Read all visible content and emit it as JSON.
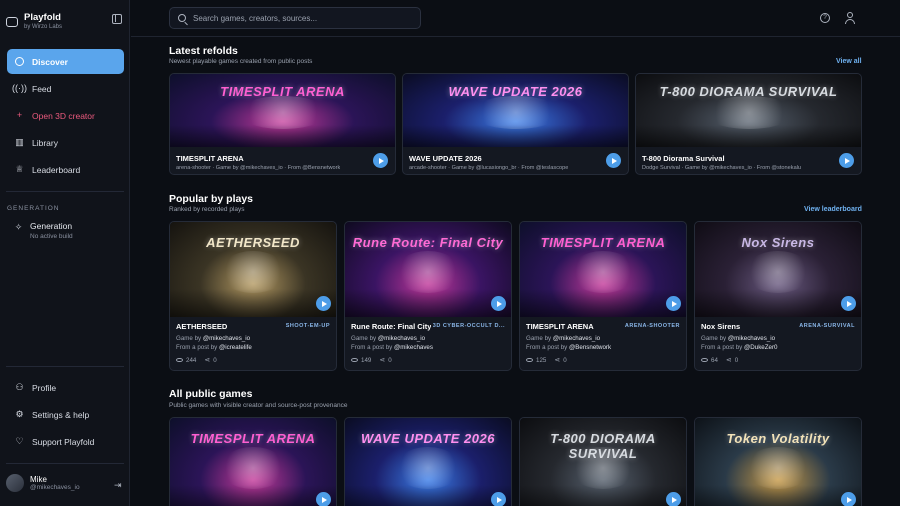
{
  "brand": {
    "name": "Playfold",
    "sub": "by Wirzo Labs"
  },
  "nav": [
    {
      "label": "Discover",
      "icon": "compass-icon"
    },
    {
      "label": "Feed",
      "icon": "broadcast-icon"
    },
    {
      "label": "Open 3D creator",
      "icon": "plus-icon"
    },
    {
      "label": "Library",
      "icon": "library-icon"
    },
    {
      "label": "Leaderboard",
      "icon": "trophy-icon"
    }
  ],
  "generation": {
    "section": "GENERATION",
    "title": "Generation",
    "status": "No active build"
  },
  "bottom_nav": [
    {
      "label": "Profile",
      "icon": "person-icon"
    },
    {
      "label": "Settings & help",
      "icon": "gear-icon"
    },
    {
      "label": "Support Playfold",
      "icon": "heart-icon"
    }
  ],
  "user": {
    "name": "Mike",
    "handle": "@mikechaves_io"
  },
  "search": {
    "placeholder": "Search games, creators, sources..."
  },
  "latest": {
    "title": "Latest refolds",
    "subtitle": "Newest playable games created from public posts",
    "link": "View all",
    "cards": [
      {
        "title": "TIMESPLIT ARENA",
        "meta": "arena-shooter · Game by @mikechaves_io · From @Bensnetwork",
        "art": "TIMESPLIT ARENA",
        "c1": "#2b1457",
        "c2": "#c43a9a",
        "c3": "#0d0f2a",
        "tc": "#ff5fd2"
      },
      {
        "title": "WAVE UPDATE 2026",
        "meta": "arcade-shooter · Game by @lucasiongo_br · From @teslascope",
        "art": "WAVE UPDATE 2026",
        "c1": "#1b1f6b",
        "c2": "#3b7de8",
        "c3": "#0a0c22",
        "tc": "#ff8ff0"
      },
      {
        "title": "T-800 Diorama Survival",
        "meta": "Dodge Survival · Game by @mikechaves_io · From @stonekalu",
        "art": "T-800 DIORAMA SURVIVAL",
        "c1": "#25282e",
        "c2": "#56606d",
        "c3": "#0c0d10",
        "tc": "#d7dbe0"
      }
    ]
  },
  "popular": {
    "title": "Popular by plays",
    "subtitle": "Ranked by recorded plays",
    "link": "View leaderboard",
    "cards": [
      {
        "title": "AETHERSEED",
        "tag": "SHOOT-EM-UP",
        "by": "@mikechaves_io",
        "from": "@icreatelife",
        "plays": "244",
        "shares": "0",
        "art": "AETHERSEED",
        "c1": "#3a3424",
        "c2": "#b49a63",
        "c3": "#15130f",
        "tc": "#f1e6c8"
      },
      {
        "title": "Rune Route: Final City",
        "tag": "3D CYBER-OCCULT D...",
        "by": "@mikechaves_io",
        "from": "@mikechaves",
        "plays": "149",
        "shares": "0",
        "art": "Rune Route: Final City",
        "c1": "#3a1463",
        "c2": "#c1389a",
        "c3": "#0e0a1f",
        "tc": "#ff6ad5"
      },
      {
        "title": "TIMESPLIT ARENA",
        "tag": "ARENA-SHOOTER",
        "by": "@mikechaves_io",
        "from": "@Bensnetwork",
        "plays": "125",
        "shares": "0",
        "art": "TIMESPLIT ARENA",
        "c1": "#2b1457",
        "c2": "#c43a9a",
        "c3": "#0d0f2a",
        "tc": "#ff5fd2"
      },
      {
        "title": "Nox Sirens",
        "tag": "ARENA-SURVIVAL",
        "by": "@mikechaves_io",
        "from": "@DukeZer0",
        "plays": "64",
        "shares": "0",
        "art": "Nox Sirens",
        "c1": "#2a2035",
        "c2": "#6a5a80",
        "c3": "#0f0c14",
        "tc": "#c9b8e6"
      }
    ]
  },
  "all": {
    "title": "All public games",
    "subtitle": "Public games with visible creator and source-post provenance",
    "cards": [
      {
        "art": "TIMESPLIT ARENA",
        "c1": "#2b1457",
        "c2": "#c43a9a",
        "c3": "#0d0f2a",
        "tc": "#ff5fd2"
      },
      {
        "art": "WAVE UPDATE 2026",
        "c1": "#1b1f6b",
        "c2": "#3b7de8",
        "c3": "#0a0c22",
        "tc": "#ff8ff0"
      },
      {
        "art": "T-800 DIORAMA SURVIVAL",
        "c1": "#25282e",
        "c2": "#56606d",
        "c3": "#0c0d10",
        "tc": "#d7dbe0"
      },
      {
        "art": "Token Volatility",
        "c1": "#2a3a48",
        "c2": "#c79a48",
        "c3": "#0d1218",
        "tc": "#f2e2b8"
      }
    ]
  },
  "labels": {
    "game_by": "Game by",
    "from_post": "From a post by"
  }
}
